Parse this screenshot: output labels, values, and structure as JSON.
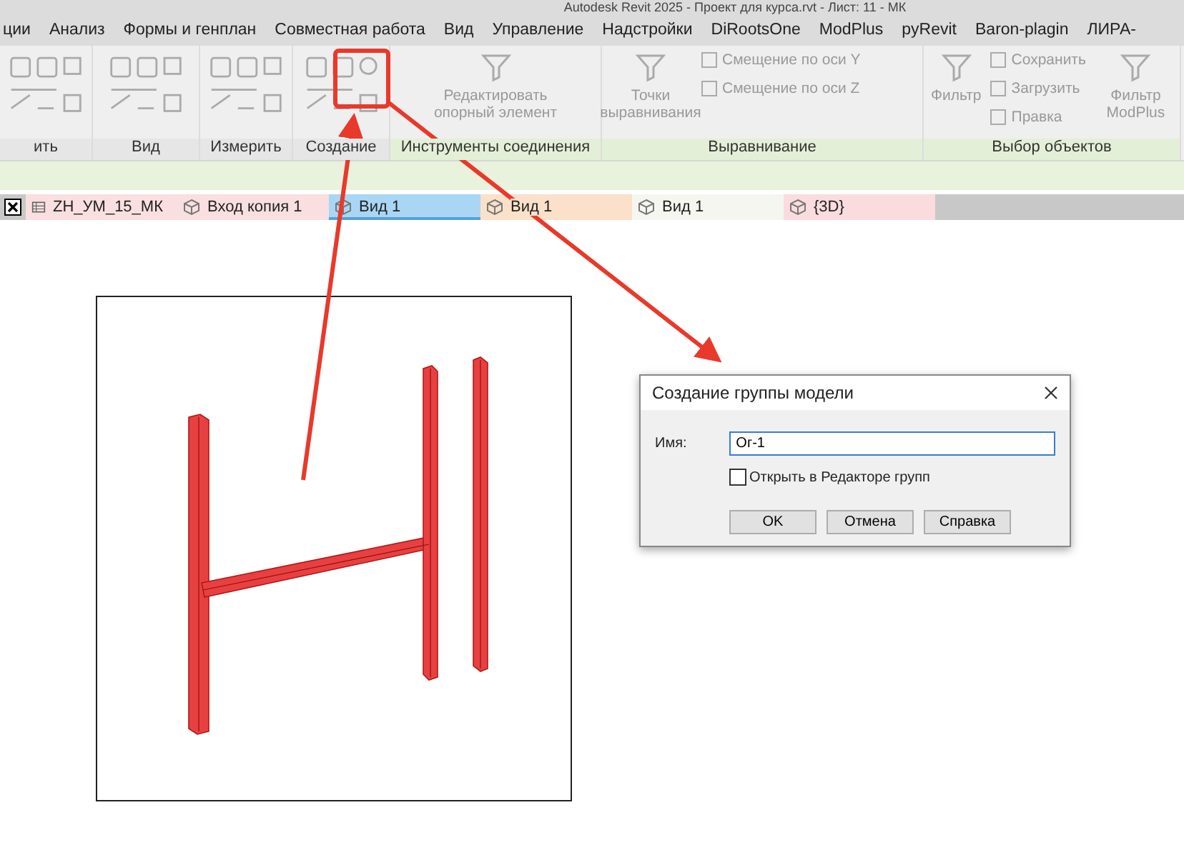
{
  "window": {
    "title": "Autodesk Revit 2025 - Проект для курса.rvt - Лист: 11 - МК"
  },
  "menu": [
    "ции",
    "Анализ",
    "Формы и генплан",
    "Совместная работа",
    "Вид",
    "Управление",
    "Надстройки",
    "DiRootsOne",
    "ModPlus",
    "pyRevit",
    "Baron-plagin",
    "ЛИРА-"
  ],
  "ribbon": {
    "panels": [
      {
        "label": "ить",
        "kind": "icons",
        "highlight": false
      },
      {
        "label": "Вид",
        "kind": "icons",
        "highlight": false
      },
      {
        "label": "Измерить",
        "kind": "icons",
        "highlight": false
      },
      {
        "label": "Создание",
        "kind": "icons",
        "highlight": true
      },
      {
        "label": "Инструменты соединения",
        "kind": "tools",
        "highlight": false,
        "tools": [
          {
            "kind": "large",
            "label": "Редактировать опорный элемент"
          }
        ]
      },
      {
        "label": "Выравнивание",
        "kind": "tools",
        "highlight": false,
        "tools": [
          {
            "kind": "large",
            "label": "Точки выравнивания"
          },
          {
            "kind": "small",
            "label": "Смещение по оси Y"
          },
          {
            "kind": "small",
            "label": "Смещение по оси Z"
          }
        ]
      },
      {
        "label": "Выбор объектов",
        "kind": "tools",
        "highlight": false,
        "tools": [
          {
            "kind": "large",
            "label": "Фильтр"
          },
          {
            "kind": "small",
            "label": "Сохранить"
          },
          {
            "kind": "small",
            "label": "Загрузить"
          },
          {
            "kind": "small",
            "label": "Правка"
          },
          {
            "kind": "large",
            "label": "Фильтр ModPlus"
          }
        ]
      }
    ]
  },
  "tabs": [
    {
      "label": "ZH_УМ_15_МК",
      "kind": "sheet",
      "color": "#f9dfe0",
      "selected": false
    },
    {
      "label": "Вход копия 1",
      "kind": "view",
      "color": "#f9dfe0",
      "selected": false
    },
    {
      "label": "Вид 1",
      "kind": "view",
      "color": "#a9d6f5",
      "selected": true
    },
    {
      "label": "Вид 1",
      "kind": "view",
      "color": "#fbe1c9",
      "selected": false
    },
    {
      "label": "Вид 1",
      "kind": "view",
      "color": "#f6f6f1",
      "selected": false
    },
    {
      "label": "{3D}",
      "kind": "view",
      "color": "#fadcdf",
      "selected": false
    }
  ],
  "dialog": {
    "title": "Создание группы модели",
    "name_label": "Имя:",
    "name_value": "Ог-1",
    "open_in_editor": {
      "label": "Открыть в Редакторе групп",
      "checked": false
    },
    "buttons": [
      "OK",
      "Отмена",
      "Справка"
    ]
  }
}
